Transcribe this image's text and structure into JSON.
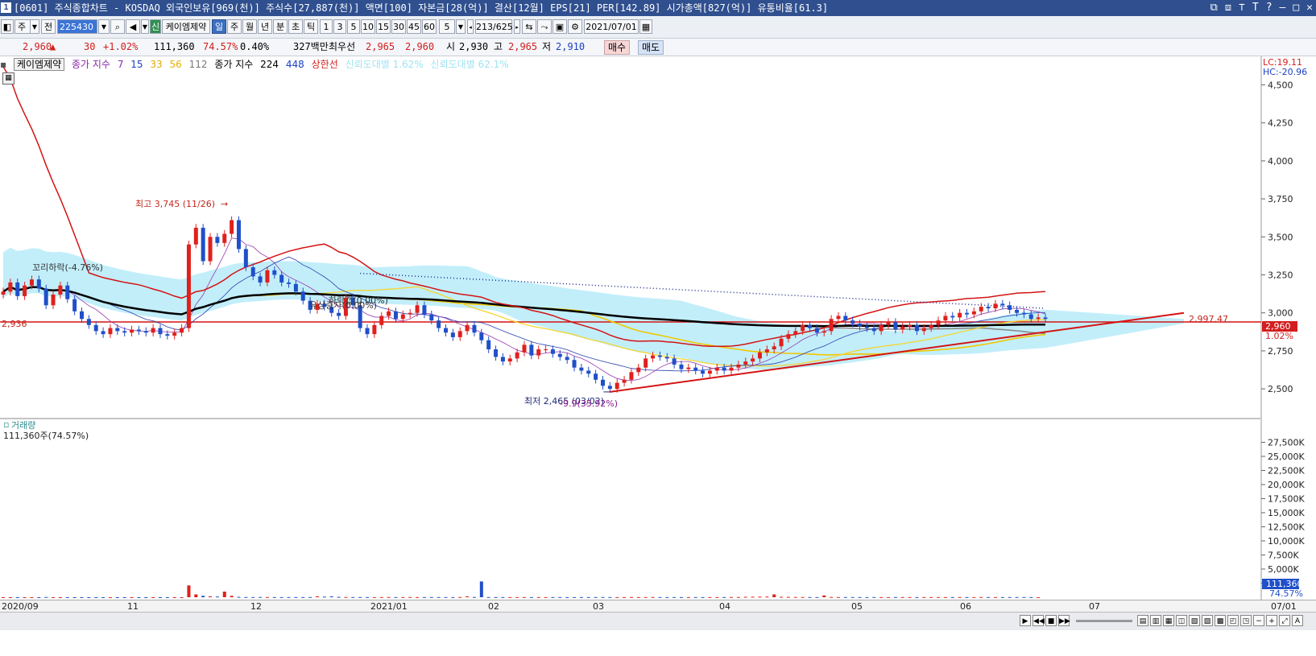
{
  "title": "[0601] 주식종합차트 - KOSDAQ 외국인보유[969(천)] 주식수[27,887(천)] 액면[100] 자본금[28(억)] 결산[12월] EPS[21] PER[142.89] 시가총액[827(억)] 유통비율[61.3]",
  "window_buttons": [
    "⧉",
    "⧈",
    "⊤",
    "T",
    "?",
    "—",
    "□",
    "✕"
  ],
  "toolbar": {
    "market": "주",
    "prev": "전",
    "code": "225430",
    "credit": "신",
    "stock_name": "케이엠제약",
    "periods": [
      "일",
      "주",
      "월",
      "년",
      "분",
      "초",
      "틱"
    ],
    "active_period": "일",
    "intervals": [
      "1",
      "3",
      "5",
      "10",
      "15",
      "30",
      "45",
      "60"
    ],
    "count": "5",
    "page": "213/625",
    "date": "2021/07/01"
  },
  "quote": {
    "price": "2,960",
    "arrow": "▲",
    "change": "30",
    "change_pct": "+1.02%",
    "volume": "111,360",
    "vol_ratio": "74.57%",
    "turnover": "0.40%",
    "amount": "327백만",
    "pref_label": "최우선",
    "ask": "2,965",
    "bid": "2,960",
    "open_label": "시",
    "open": "2,930",
    "high_label": "고",
    "high": "2,965",
    "low_label": "저",
    "low": "2,910",
    "buy": "매수",
    "sell": "매도"
  },
  "legend": {
    "stock": "케이엠제약",
    "ma1_label": "종가 지수",
    "ma1_periods": [
      "7",
      "15",
      "33",
      "56",
      "112"
    ],
    "ma2_label": "종가 지수",
    "ma2_periods": [
      "224",
      "448"
    ],
    "limit": "상한선",
    "faded1": "신뢰도대별 1.62%",
    "faded2": "신뢰도대별 62.1%"
  },
  "right_info": {
    "lc": "LC:19.11",
    "hc": "HC:-20.96"
  },
  "annotations": {
    "high": "최고 3,745 (11/26)",
    "low": "최저 2,465 (03/02)",
    "low_sub": "-9.9(33.92%)",
    "retrace": "꼬리하락(-4.76%)",
    "gap1": "하락갭(0.00%)",
    "gap2": "유상증자(0.00%)",
    "left_price": "2,936",
    "target": "2,997.47",
    "price_tag": "2,960",
    "price_pct": "1.02%"
  },
  "colors": {
    "up": "#e0201c",
    "down": "#1f4fc9",
    "cloud": "#8fe0f5",
    "bollinger": "#d41414",
    "ma_black": "#000000"
  },
  "chart_data": {
    "type": "candlestick",
    "price_axis": {
      "min": 2400,
      "max": 4550,
      "ticks": [
        "4,500",
        "4,250",
        "4,000",
        "3,750",
        "3,500",
        "3,250",
        "3,000",
        "2,750",
        "2,500"
      ]
    },
    "volume_axis": {
      "min": 0,
      "max": 30000,
      "ticks": [
        "27,500K",
        "25,000K",
        "22,500K",
        "20,000K",
        "17,500K",
        "15,000K",
        "12,500K",
        "10,000K",
        "7,500K",
        "5,000K",
        "2,500K"
      ]
    },
    "volume_panel": {
      "label": "거래량",
      "current": "111,360주(74.57%)",
      "tag": "111,360",
      "tag_pct": "74.57%"
    },
    "x_labels": [
      "2020/09",
      "11",
      "12",
      "2021/01",
      "02",
      "03",
      "04",
      "05",
      "06",
      "07",
      "07/01"
    ],
    "close_series": [
      3140,
      3200,
      3110,
      3180,
      3220,
      3160,
      3050,
      3120,
      3180,
      3090,
      3010,
      2960,
      2920,
      2880,
      2860,
      2900,
      2880,
      2870,
      2890,
      2880,
      2870,
      2900,
      2860,
      2850,
      2870,
      2900,
      3450,
      3560,
      3340,
      3500,
      3460,
      3520,
      3610,
      3420,
      3300,
      3240,
      3200,
      3280,
      3250,
      3200,
      3190,
      3140,
      3080,
      3020,
      3060,
      3040,
      3000,
      2980,
      3100,
      3050,
      2900,
      2860,
      2920,
      2980,
      3010,
      2960,
      2990,
      3000,
      3050,
      2990,
      2950,
      2900,
      2870,
      2840,
      2880,
      2920,
      2870,
      2820,
      2760,
      2710,
      2680,
      2700,
      2740,
      2790,
      2720,
      2760,
      2760,
      2730,
      2710,
      2690,
      2640,
      2620,
      2600,
      2560,
      2520,
      2500,
      2540,
      2560,
      2610,
      2640,
      2700,
      2720,
      2710,
      2700,
      2660,
      2630,
      2640,
      2620,
      2600,
      2620,
      2640,
      2620,
      2640,
      2660,
      2680,
      2700,
      2740,
      2760,
      2780,
      2830,
      2860,
      2880,
      2920,
      2900,
      2870,
      2880,
      2960,
      2980,
      2950,
      2930,
      2910,
      2900,
      2880,
      2920,
      2940,
      2890,
      2910,
      2920,
      2880,
      2900,
      2920,
      2950,
      2980,
      2970,
      3000,
      2990,
      3010,
      3040,
      3030,
      3060,
      3050,
      3020,
      3000,
      2990,
      2960,
      2970,
      2960
    ],
    "volume_series": [
      9,
      3,
      5,
      2,
      6,
      4,
      40,
      8,
      5,
      4,
      3,
      2,
      2,
      3,
      5,
      6,
      2,
      2,
      3,
      2,
      3,
      2,
      2,
      2,
      4,
      3,
      2100,
      500,
      250,
      160,
      120,
      1000,
      250,
      60,
      30,
      25,
      40,
      30,
      25,
      20,
      30,
      25,
      20,
      30,
      160,
      100,
      160,
      60,
      40,
      30,
      30,
      25,
      20,
      30,
      35,
      25,
      30,
      40,
      25,
      20,
      30,
      30,
      25,
      20,
      35,
      160,
      40,
      2800,
      30,
      20,
      25,
      20,
      30,
      25,
      20,
      30,
      25,
      20,
      20,
      15,
      18,
      22,
      25,
      30,
      35,
      25,
      25,
      20,
      40,
      30,
      30,
      35,
      25,
      20,
      30,
      25,
      20,
      25,
      20,
      25,
      30,
      25,
      35,
      40,
      80,
      80,
      100,
      120,
      500,
      80,
      60,
      50,
      40,
      30,
      25,
      320,
      40,
      30,
      35,
      30,
      25,
      20,
      30,
      25,
      20,
      25,
      30,
      25,
      20,
      25,
      30,
      35,
      25,
      20,
      30,
      25,
      20,
      40,
      30,
      25,
      20,
      30,
      30,
      25,
      20,
      11
    ]
  }
}
